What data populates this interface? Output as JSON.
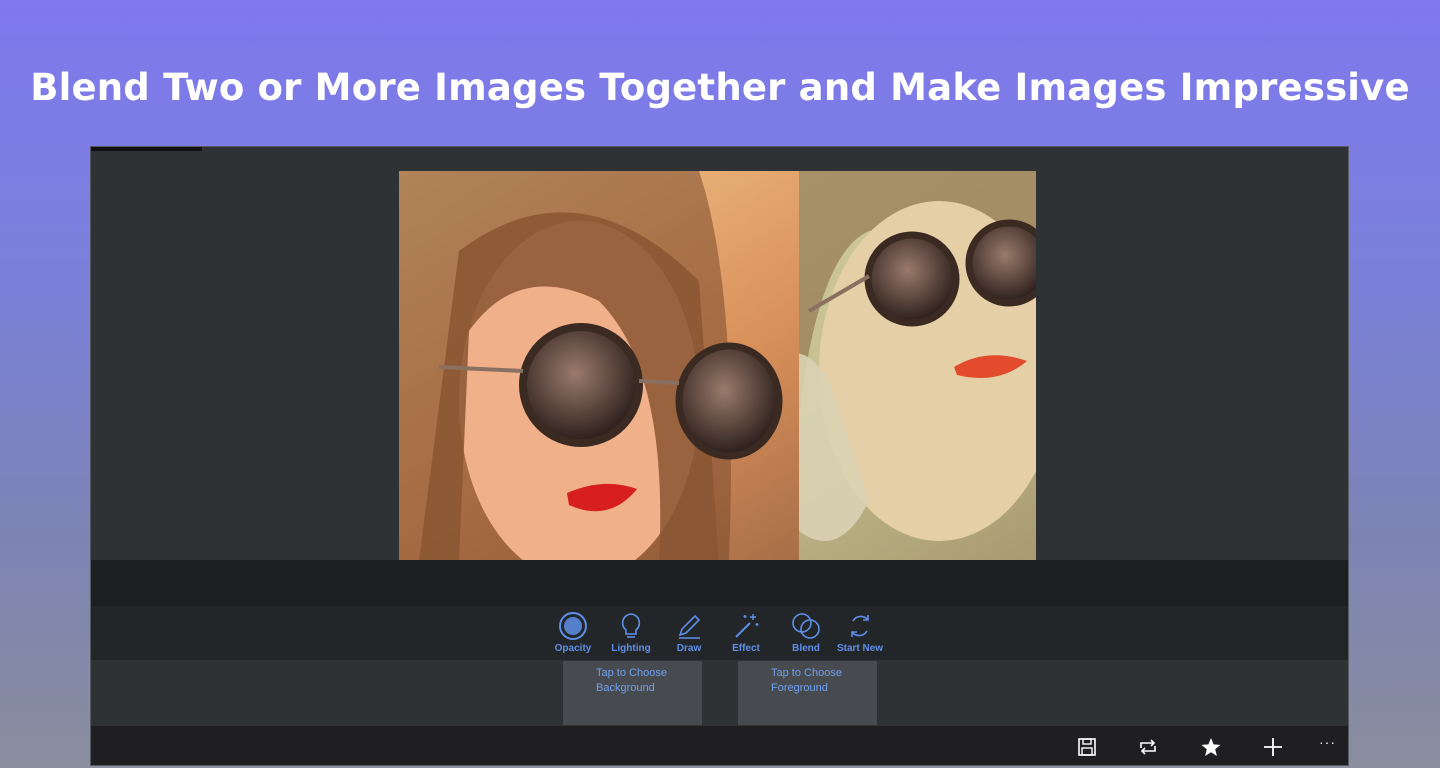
{
  "headline": "Blend Two or More Images Together and Make Images Impressive",
  "toolbar": {
    "items": [
      {
        "label": "Opacity",
        "icon": "opacity-icon"
      },
      {
        "label": "Lighting",
        "icon": "lightbulb-icon"
      },
      {
        "label": "Draw",
        "icon": "pencil-icon"
      },
      {
        "label": "Effect",
        "icon": "magic-wand-icon"
      },
      {
        "label": "Blend",
        "icon": "blend-circles-icon"
      },
      {
        "label": "Start New",
        "icon": "refresh-icon"
      }
    ]
  },
  "choosers": {
    "background": {
      "line1": "Tap to Choose",
      "line2": "Background"
    },
    "foreground": {
      "line1": "Tap to Choose",
      "line2": "Foreground"
    }
  },
  "command_bar": {
    "icons": [
      "save-icon",
      "repeat-icon",
      "star-icon",
      "plus-icon"
    ],
    "more": "···"
  },
  "colors": {
    "accent": "#5e8fe8",
    "panel": "#2f3234",
    "command_bar": "#1f1f21"
  }
}
